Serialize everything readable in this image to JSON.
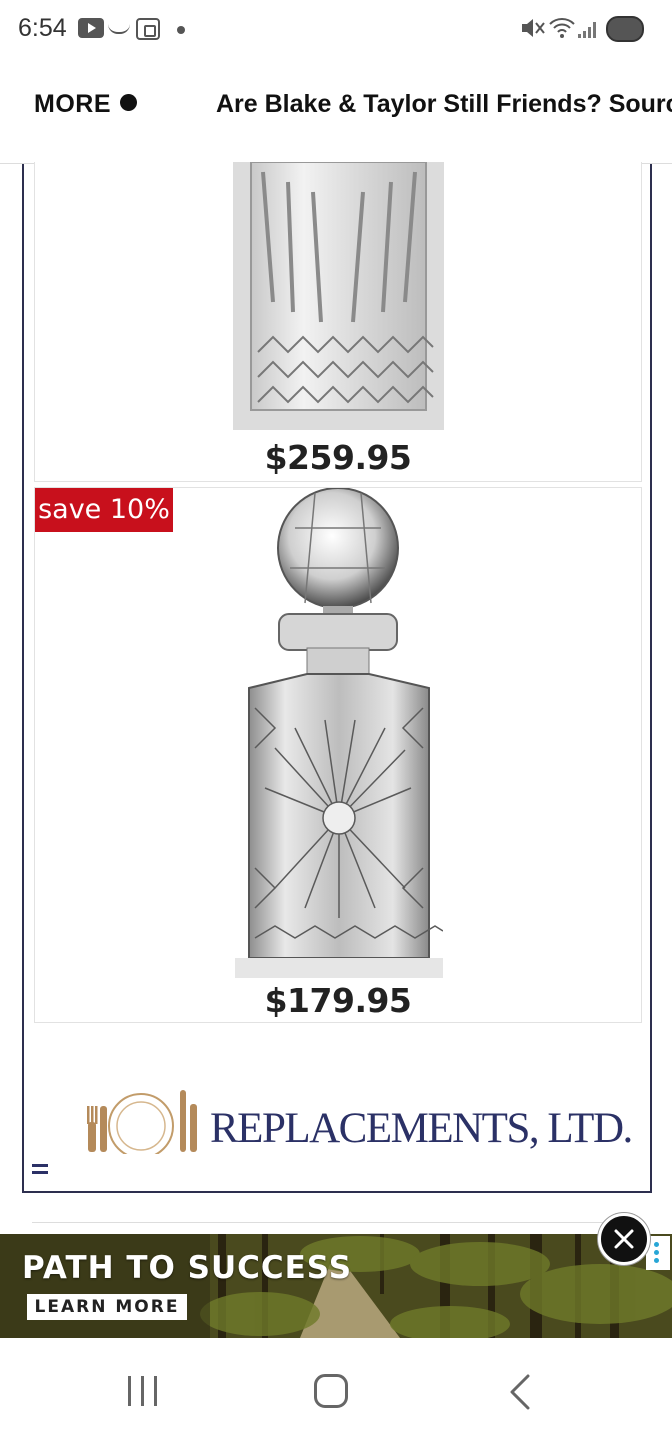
{
  "status_bar": {
    "time": "6:54",
    "icons": [
      "youtube-icon",
      "amazon-icon",
      "screenshot-icon",
      "notification-dot-icon",
      "mute-icon",
      "wifi-icon",
      "signal-icon",
      "battery-icon"
    ]
  },
  "top_nav": {
    "more_label": "MORE",
    "headline": "Are Blake & Taylor Still Friends? Sources"
  },
  "ad": {
    "products": [
      {
        "price": "$259.95",
        "badge": "",
        "image": "crystal-highball-glass"
      },
      {
        "price": "$179.95",
        "badge": "save 10%",
        "image": "crystal-decanter"
      }
    ],
    "brand_logo_text": "REPLACEMENTS, LTD.",
    "colors": {
      "frame": "#2d2f4f",
      "badge": "#c8101c",
      "brand": "#2b3166"
    }
  },
  "banner": {
    "title": "PATH TO SUCCESS",
    "cta": "LEARN MORE"
  },
  "nav_bar": {
    "buttons": [
      "recent-apps",
      "home",
      "back"
    ]
  }
}
